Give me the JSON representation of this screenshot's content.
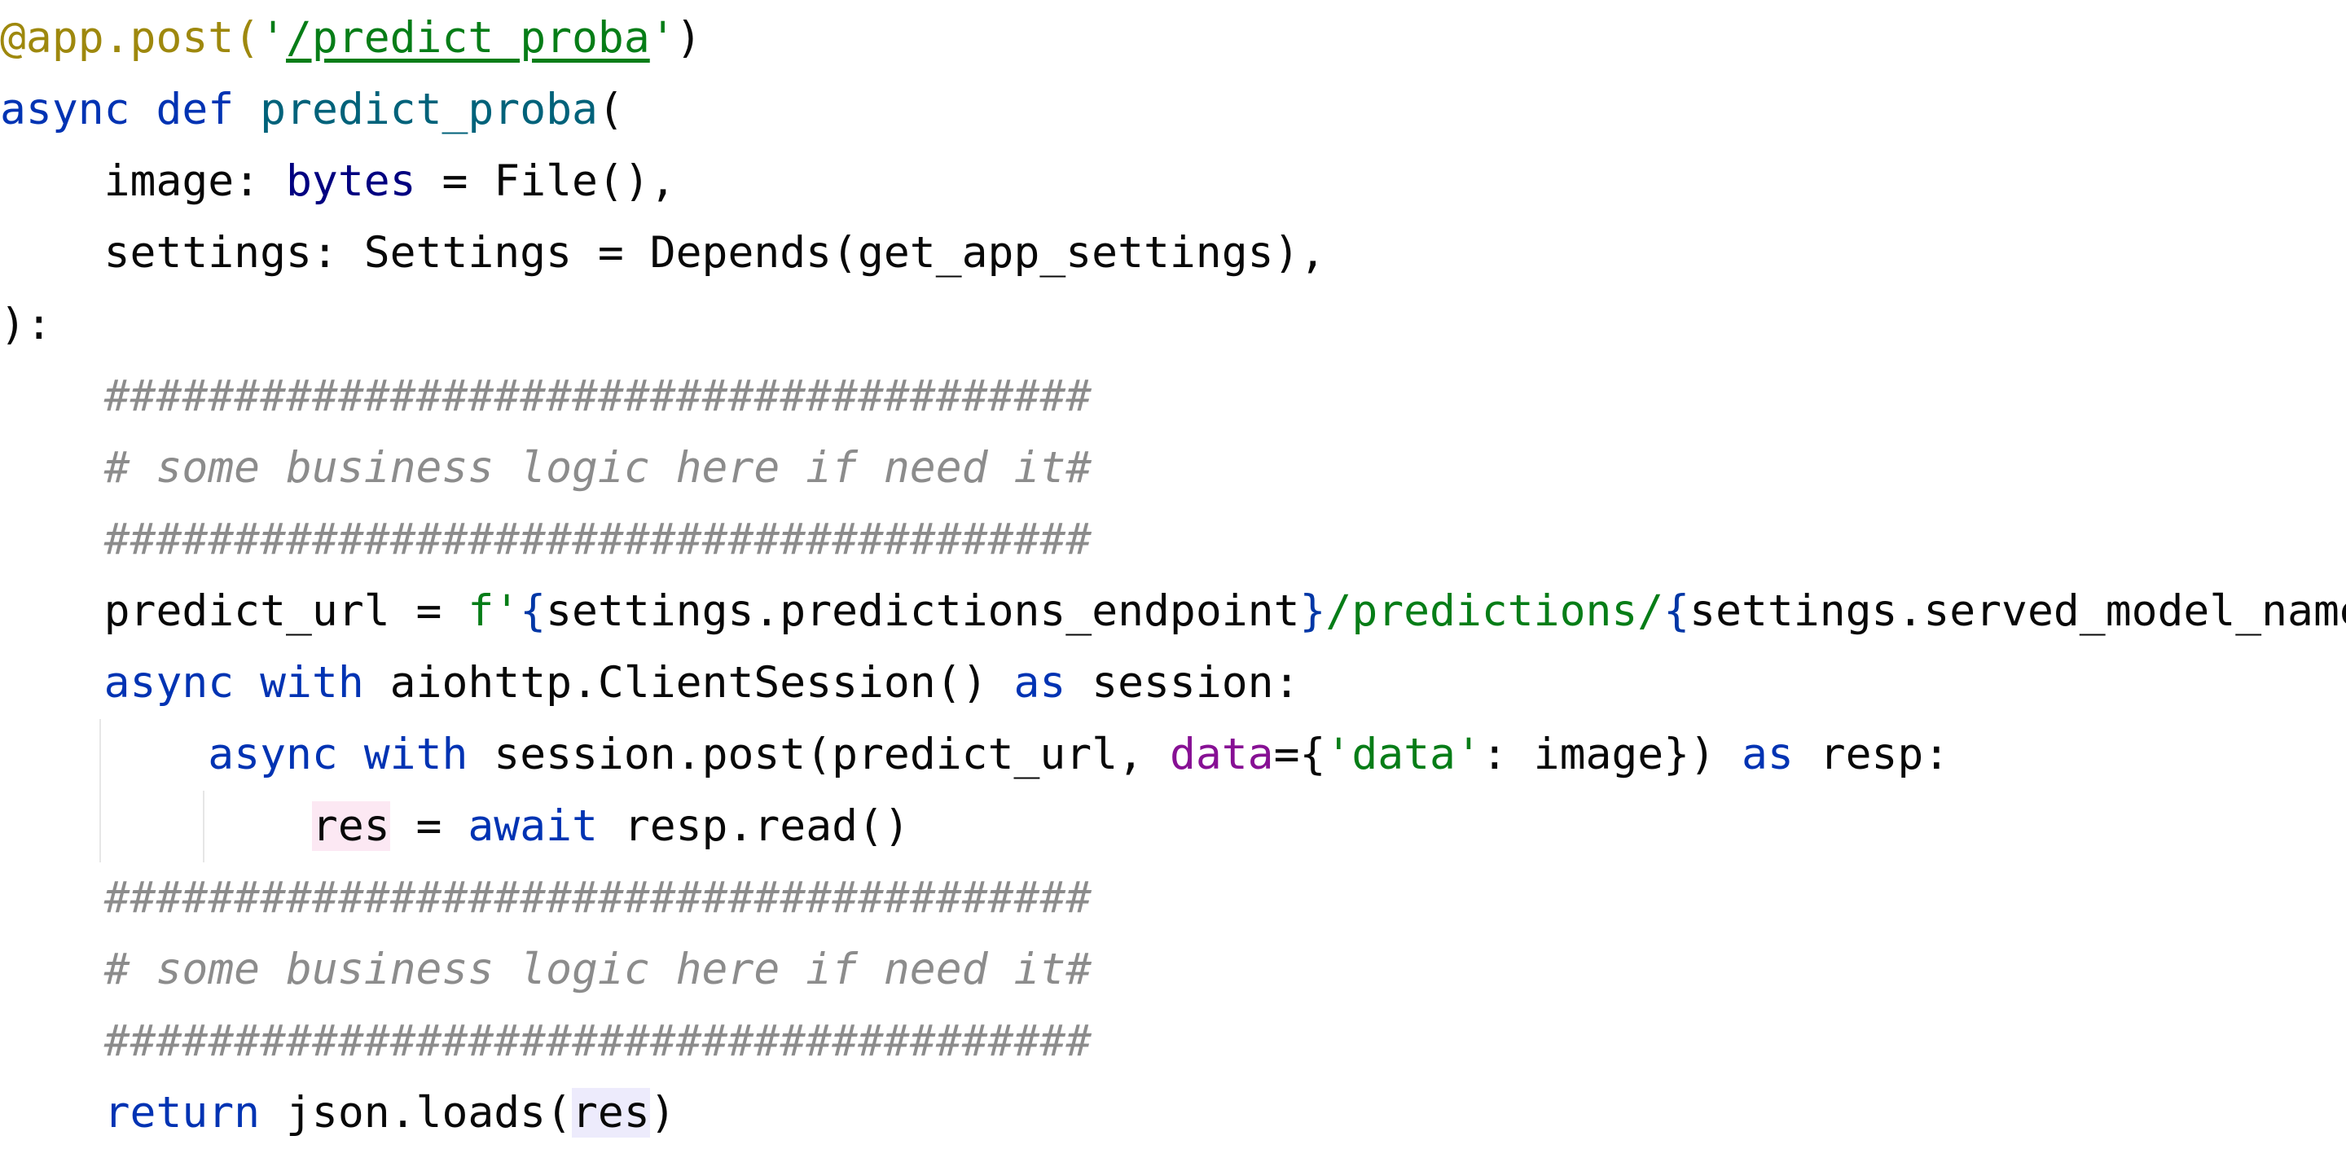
{
  "editor": {
    "lines": [
      {
        "indent": 0,
        "tokens": [
          {
            "t": "@app.post(",
            "c": "deco"
          },
          {
            "t": "'",
            "c": "str"
          },
          {
            "t": "/predict_proba",
            "c": "url"
          },
          {
            "t": "'",
            "c": "str"
          },
          {
            "t": ")",
            "c": "plain"
          }
        ]
      },
      {
        "indent": 0,
        "tokens": [
          {
            "t": "async",
            "c": "kw"
          },
          {
            "t": " ",
            "c": "plain"
          },
          {
            "t": "def",
            "c": "kw"
          },
          {
            "t": " ",
            "c": "plain"
          },
          {
            "t": "predict_proba",
            "c": "fn"
          },
          {
            "t": "(",
            "c": "plain"
          }
        ]
      },
      {
        "indent": 4,
        "tokens": [
          {
            "t": "image: ",
            "c": "plain"
          },
          {
            "t": "bytes",
            "c": "builtin"
          },
          {
            "t": " = File(),",
            "c": "plain"
          }
        ]
      },
      {
        "indent": 4,
        "tokens": [
          {
            "t": "settings: Settings = Depends(get_app_settings),",
            "c": "plain"
          }
        ]
      },
      {
        "indent": 0,
        "tokens": [
          {
            "t": "):",
            "c": "plain"
          }
        ]
      },
      {
        "indent": 4,
        "tokens": [
          {
            "t": "######################################",
            "c": "cmt"
          }
        ]
      },
      {
        "indent": 4,
        "tokens": [
          {
            "t": "# some business logic here if need it#",
            "c": "cmt"
          }
        ]
      },
      {
        "indent": 4,
        "tokens": [
          {
            "t": "######################################",
            "c": "cmt"
          }
        ]
      },
      {
        "indent": 4,
        "tokens": [
          {
            "t": "predict_url = ",
            "c": "plain"
          },
          {
            "t": "f'",
            "c": "str"
          },
          {
            "t": "{",
            "c": "brace"
          },
          {
            "t": "settings.predictions_endpoint",
            "c": "plain"
          },
          {
            "t": "}",
            "c": "brace"
          },
          {
            "t": "/predictions/",
            "c": "str"
          },
          {
            "t": "{",
            "c": "brace"
          },
          {
            "t": "settings.served_model_name",
            "c": "plain"
          },
          {
            "t": "}",
            "c": "brace"
          },
          {
            "t": "'",
            "c": "str"
          }
        ]
      },
      {
        "indent": 4,
        "tokens": [
          {
            "t": "async",
            "c": "kw"
          },
          {
            "t": " ",
            "c": "plain"
          },
          {
            "t": "with",
            "c": "kw"
          },
          {
            "t": " aiohttp.ClientSession() ",
            "c": "plain"
          },
          {
            "t": "as",
            "c": "kw"
          },
          {
            "t": " session:",
            "c": "plain"
          }
        ]
      },
      {
        "indent": 8,
        "tokens": [
          {
            "t": "async",
            "c": "kw"
          },
          {
            "t": " ",
            "c": "plain"
          },
          {
            "t": "with",
            "c": "kw"
          },
          {
            "t": " session.post(predict_url, ",
            "c": "plain"
          },
          {
            "t": "data",
            "c": "named"
          },
          {
            "t": "={",
            "c": "plain"
          },
          {
            "t": "'data'",
            "c": "str"
          },
          {
            "t": ": image}) ",
            "c": "plain"
          },
          {
            "t": "as",
            "c": "kw"
          },
          {
            "t": " resp:",
            "c": "plain"
          }
        ]
      },
      {
        "indent": 12,
        "tokens": [
          {
            "t": "res",
            "c": "hl-write"
          },
          {
            "t": " = ",
            "c": "plain"
          },
          {
            "t": "await",
            "c": "kw"
          },
          {
            "t": " resp.read()",
            "c": "plain"
          }
        ]
      },
      {
        "indent": 4,
        "tokens": [
          {
            "t": "######################################",
            "c": "cmt"
          }
        ]
      },
      {
        "indent": 4,
        "tokens": [
          {
            "t": "# some business logic here if need it#",
            "c": "cmt"
          }
        ]
      },
      {
        "indent": 4,
        "tokens": [
          {
            "t": "######################################",
            "c": "cmt"
          }
        ]
      },
      {
        "indent": 4,
        "tokens": [
          {
            "t": "return",
            "c": "kw"
          },
          {
            "t": " json.loads(",
            "c": "plain"
          },
          {
            "t": "res",
            "c": "hl-read"
          },
          {
            "t": ")",
            "c": "plain"
          }
        ]
      }
    ]
  },
  "colors": {
    "background": "#ffffff",
    "keyword": "#0033b3",
    "function": "#00627a",
    "decorator": "#9e880d",
    "string": "#067d17",
    "comment": "#8c8c8c",
    "builtin": "#000080",
    "named_arg": "#871094",
    "write_highlight": "#fce8f3",
    "read_highlight": "#edebfc"
  }
}
